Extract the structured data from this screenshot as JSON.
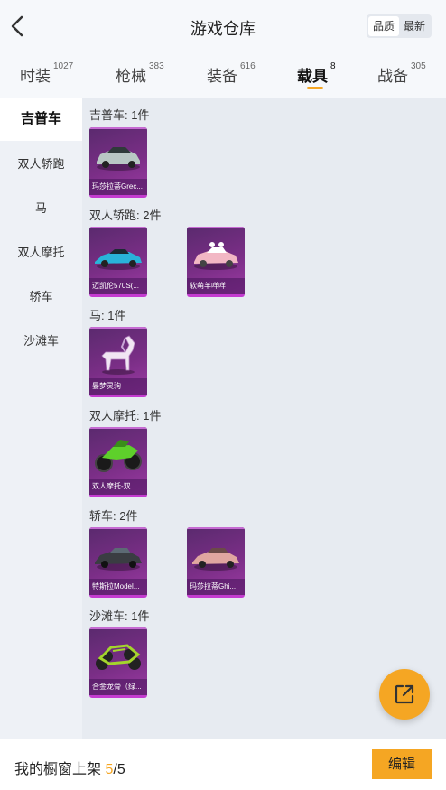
{
  "header": {
    "title": "游戏仓库",
    "sort_options": [
      "品质",
      "最新"
    ],
    "active_sort": "品质"
  },
  "tabs": [
    {
      "label": "时装",
      "count": "1027"
    },
    {
      "label": "枪械",
      "count": "383"
    },
    {
      "label": "装备",
      "count": "616"
    },
    {
      "label": "载具",
      "count": "8"
    },
    {
      "label": "战备",
      "count": "305"
    }
  ],
  "active_tab": "载具",
  "sidebar": {
    "items": [
      "吉普车",
      "双人轿跑",
      "马",
      "双人摩托",
      "轿车",
      "沙滩车"
    ],
    "active": "吉普车"
  },
  "sections": [
    {
      "label": "吉普车: 1件",
      "items": [
        {
          "name": "玛莎拉蒂Grec...",
          "icon": "car-icon"
        }
      ]
    },
    {
      "label": "双人轿跑: 2件",
      "items": [
        {
          "name": "迈凯伦570S(...",
          "icon": "car-icon"
        },
        {
          "name": "软萌羊咩咩",
          "icon": "car-icon"
        }
      ]
    },
    {
      "label": "马: 1件",
      "items": [
        {
          "name": "晏梦灵驹",
          "icon": "horse-icon"
        }
      ]
    },
    {
      "label": "双人摩托: 1件",
      "items": [
        {
          "name": "双人摩托-双...",
          "icon": "motorcycle-icon"
        }
      ]
    },
    {
      "label": "轿车: 2件",
      "items": [
        {
          "name": "特斯拉Model...",
          "icon": "car-icon"
        },
        {
          "name": "玛莎拉蒂Ghi...",
          "icon": "car-icon"
        }
      ]
    },
    {
      "label": "沙滩车: 1件",
      "items": [
        {
          "name": "合金龙骨（绿...",
          "icon": "buggy-icon"
        }
      ]
    }
  ],
  "footer": {
    "label": "我的橱窗上架",
    "current": "5",
    "separator": "/",
    "total": "5",
    "edit_label": "编辑"
  },
  "colors": {
    "accent": "#f5a623",
    "card_bg": "#7a2e86",
    "card_border": "#c43bd0"
  }
}
